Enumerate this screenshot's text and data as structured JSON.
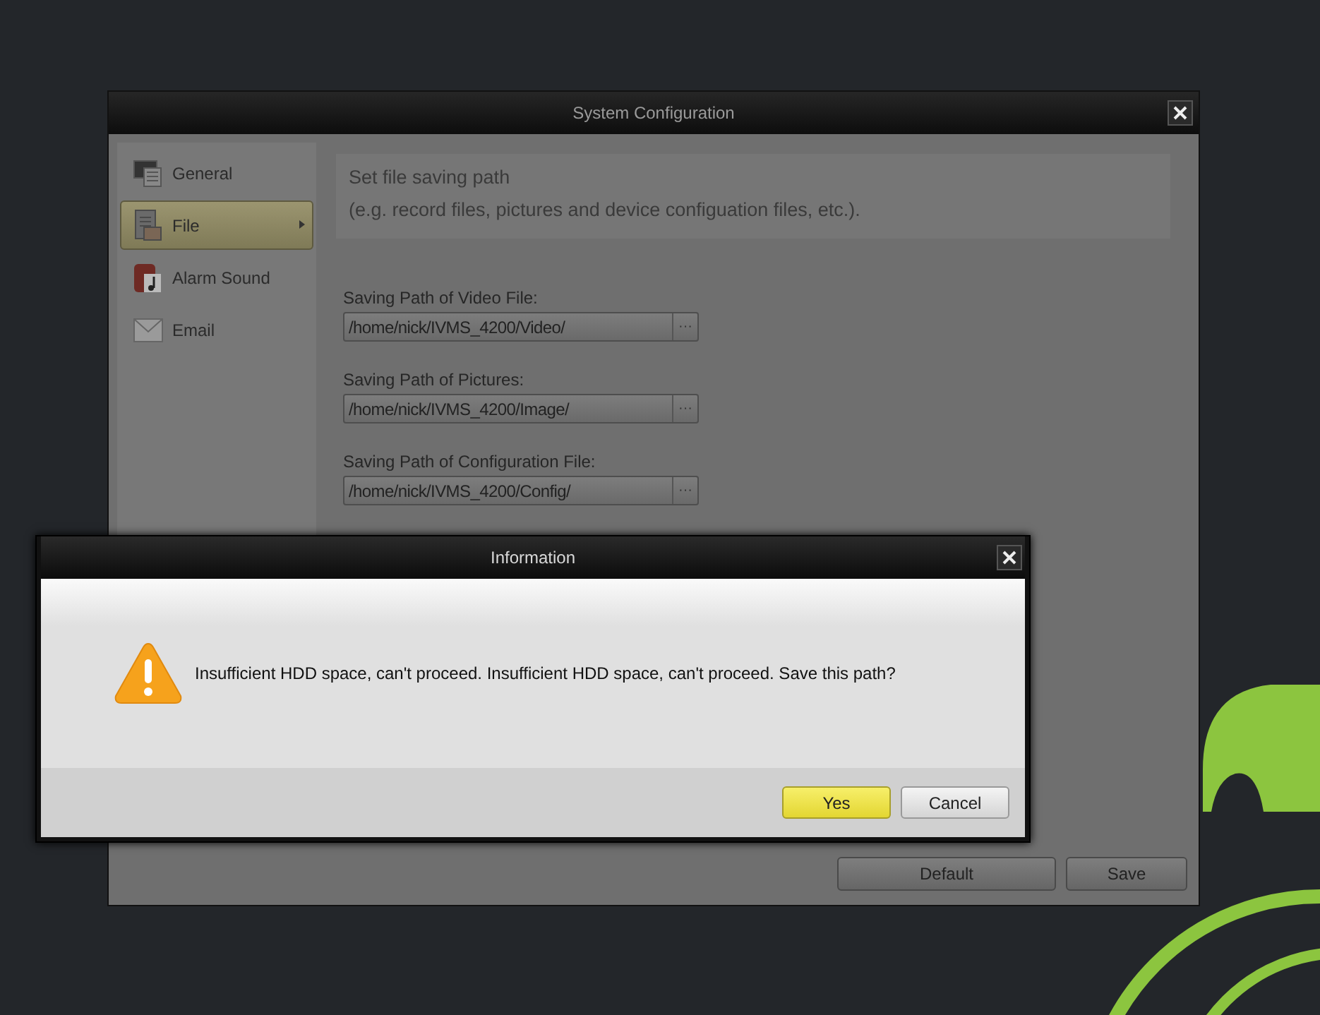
{
  "window": {
    "title": "System Configuration"
  },
  "sidebar": {
    "items": [
      {
        "label": "General",
        "kind": "monitor",
        "selected": false
      },
      {
        "label": "File",
        "kind": "file",
        "selected": true
      },
      {
        "label": "Alarm Sound",
        "kind": "sound",
        "selected": false
      },
      {
        "label": "Email",
        "kind": "mail",
        "selected": false
      }
    ]
  },
  "header": {
    "title": "Set file saving path",
    "hint": "(e.g. record files, pictures and device configuation files, etc.)."
  },
  "paths": [
    {
      "label": "Saving Path of Video File:",
      "value": "/home/nick/IVMS_4200/Video/",
      "browse": "···"
    },
    {
      "label": "Saving Path of Pictures:",
      "value": "/home/nick/IVMS_4200/Image/",
      "browse": "···"
    },
    {
      "label": "Saving Path of Configuration File:",
      "value": "/home/nick/IVMS_4200/Config/",
      "browse": "···"
    }
  ],
  "buttons": [
    "Default",
    "Save"
  ],
  "dialog": {
    "title": "Information",
    "message": "Insufficient HDD space, can't proceed. Insufficient HDD space, can't proceed. Save this path?",
    "buttons": [
      {
        "label": "Yes",
        "default": true
      },
      {
        "label": "Cancel",
        "default": false
      }
    ]
  }
}
